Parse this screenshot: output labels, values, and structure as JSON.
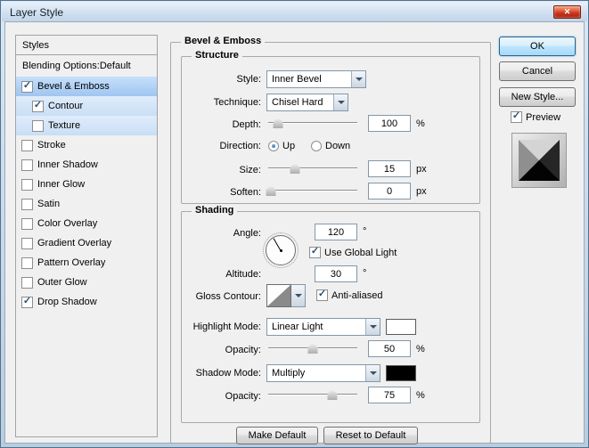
{
  "window": {
    "title": "Layer Style"
  },
  "icons": {
    "check": "✓",
    "close": "✕"
  },
  "sidebar": {
    "styles_header": "Styles",
    "blending_options": "Blending Options:Default",
    "items": [
      {
        "label": "Bevel & Emboss",
        "checked": true,
        "selected": true
      },
      {
        "label": "Contour",
        "checked": true,
        "highlighted": true
      },
      {
        "label": "Texture",
        "checked": false,
        "highlighted": true
      },
      {
        "label": "Stroke",
        "checked": false
      },
      {
        "label": "Inner Shadow",
        "checked": false
      },
      {
        "label": "Inner Glow",
        "checked": false
      },
      {
        "label": "Satin",
        "checked": false
      },
      {
        "label": "Color Overlay",
        "checked": false
      },
      {
        "label": "Gradient Overlay",
        "checked": false
      },
      {
        "label": "Pattern Overlay",
        "checked": false
      },
      {
        "label": "Outer Glow",
        "checked": false
      },
      {
        "label": "Drop Shadow",
        "checked": true
      }
    ]
  },
  "main": {
    "title": "Bevel & Emboss",
    "structure": {
      "legend": "Structure",
      "style": {
        "label": "Style:",
        "value": "Inner Bevel"
      },
      "technique": {
        "label": "Technique:",
        "value": "Chisel Hard"
      },
      "depth": {
        "label": "Depth:",
        "value": "100",
        "unit": "%",
        "pos": "11%"
      },
      "direction": {
        "label": "Direction:",
        "options": [
          "Up",
          "Down"
        ],
        "selected": "Up"
      },
      "size": {
        "label": "Size:",
        "value": "15",
        "unit": "px",
        "pos": "30%"
      },
      "soften": {
        "label": "Soften:",
        "value": "0",
        "unit": "px",
        "pos": "3%"
      }
    },
    "shading": {
      "legend": "Shading",
      "angle": {
        "label": "Angle:",
        "value": "120",
        "unit": "°"
      },
      "use_global_light": {
        "label": "Use Global Light",
        "checked": true
      },
      "altitude": {
        "label": "Altitude:",
        "value": "30",
        "unit": "°"
      },
      "gloss_contour": {
        "label": "Gloss Contour:"
      },
      "anti_aliased": {
        "label": "Anti-aliased",
        "checked": true
      },
      "highlight_mode": {
        "label": "Highlight Mode:",
        "value": "Linear Light",
        "color": "#ffffff"
      },
      "highlight_opacity": {
        "label": "Opacity:",
        "value": "50",
        "unit": "%",
        "pos": "50%"
      },
      "shadow_mode": {
        "label": "Shadow Mode:",
        "value": "Multiply",
        "color": "#000000"
      },
      "shadow_opacity": {
        "label": "Opacity:",
        "value": "75",
        "unit": "%",
        "pos": "72%"
      }
    },
    "footer_buttons": {
      "make_default": "Make Default",
      "reset_to_default": "Reset to Default"
    }
  },
  "actions": {
    "ok": "OK",
    "cancel": "Cancel",
    "new_style": "New Style...",
    "preview_label": "Preview",
    "preview_checked": true
  }
}
